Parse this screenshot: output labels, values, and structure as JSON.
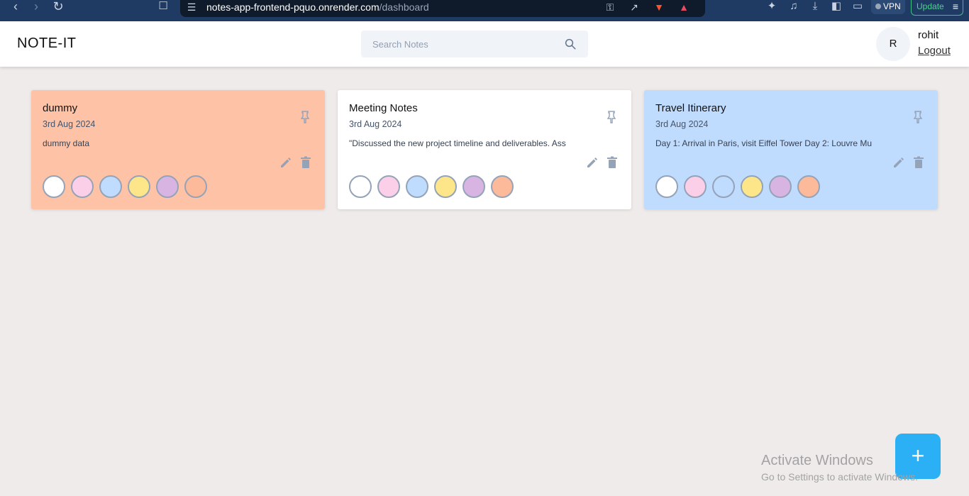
{
  "browser": {
    "url_host": "notes-app-frontend-pquo.onrender.com",
    "url_path": "/dashboard",
    "vpn_label": "VPN",
    "update_label": "Update"
  },
  "header": {
    "logo": "NOTE-IT",
    "search_placeholder": "Search Notes",
    "avatar_initial": "R",
    "username": "rohit",
    "logout_label": "Logout"
  },
  "colors": {
    "swatches": [
      "#ffffff",
      "#fbcfe8",
      "#bfdbfe",
      "#fde68a",
      "#d8b4e2",
      "#fdba9a"
    ],
    "accent": "#2bb0f5"
  },
  "notes": [
    {
      "title": "dummy",
      "date": "3rd Aug 2024",
      "content": "dummy data",
      "bg": "#fec3a6"
    },
    {
      "title": "Meeting Notes",
      "date": "3rd Aug 2024",
      "content": "\"Discussed the new project timeline and deliverables. Ass",
      "bg": "#ffffff"
    },
    {
      "title": "Travel Itinerary",
      "date": "3rd Aug 2024",
      "content": "Day 1: Arrival in Paris, visit Eiffel Tower Day 2: Louvre Mu",
      "bg": "#bfdbfe"
    }
  ],
  "fab": {
    "label": "+"
  },
  "watermark": {
    "title": "Activate Windows",
    "subtitle": "Go to Settings to activate Windows."
  }
}
